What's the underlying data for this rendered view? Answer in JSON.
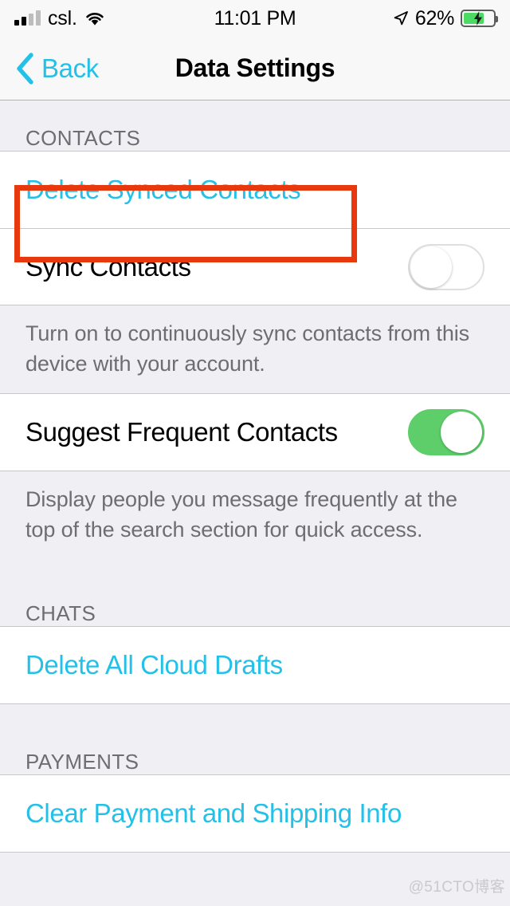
{
  "status_bar": {
    "carrier": "csl.",
    "time": "11:01 PM",
    "battery_percent": "62%",
    "battery_level": 62,
    "signal_bars_filled": 2,
    "signal_bars_total": 4,
    "wifi_icon": "wifi-icon",
    "location_icon": "location-arrow-icon",
    "battery_icon": "battery-charging-icon",
    "charging": true
  },
  "nav": {
    "back_label": "Back",
    "back_icon": "chevron-left-icon",
    "title": "Data Settings"
  },
  "sections": [
    {
      "header": "CONTACTS",
      "rows": [
        {
          "label": "Delete Synced Contacts",
          "type": "link",
          "name": "delete-synced-contacts"
        },
        {
          "label": "Sync Contacts",
          "type": "toggle",
          "value": false,
          "name": "sync-contacts"
        }
      ],
      "footnote": "Turn on to continuously sync contacts from this device with your account."
    },
    {
      "header": "",
      "rows": [
        {
          "label": "Suggest Frequent Contacts",
          "type": "toggle",
          "value": true,
          "name": "suggest-frequent-contacts"
        }
      ],
      "footnote": "Display people you message frequently at the top of the search section for quick access."
    },
    {
      "header": "CHATS",
      "rows": [
        {
          "label": "Delete All Cloud Drafts",
          "type": "link",
          "name": "delete-all-cloud-drafts"
        }
      ],
      "footnote": ""
    },
    {
      "header": "PAYMENTS",
      "rows": [
        {
          "label": "Clear Payment and Shipping Info",
          "type": "link",
          "name": "clear-payment-and-shipping-info"
        }
      ],
      "footnote": ""
    }
  ],
  "highlight": {
    "color": "#E8390E",
    "target": "Delete Synced Contacts"
  },
  "watermark": "@51CTO博客",
  "colors": {
    "tint": "#23C1E8",
    "toggle_on": "#5DCE6A",
    "group_bg": "#FFFFFF",
    "page_bg": "#EFEFF4",
    "secondary_text": "#6D6D72",
    "separator": "#C8C7CC"
  }
}
